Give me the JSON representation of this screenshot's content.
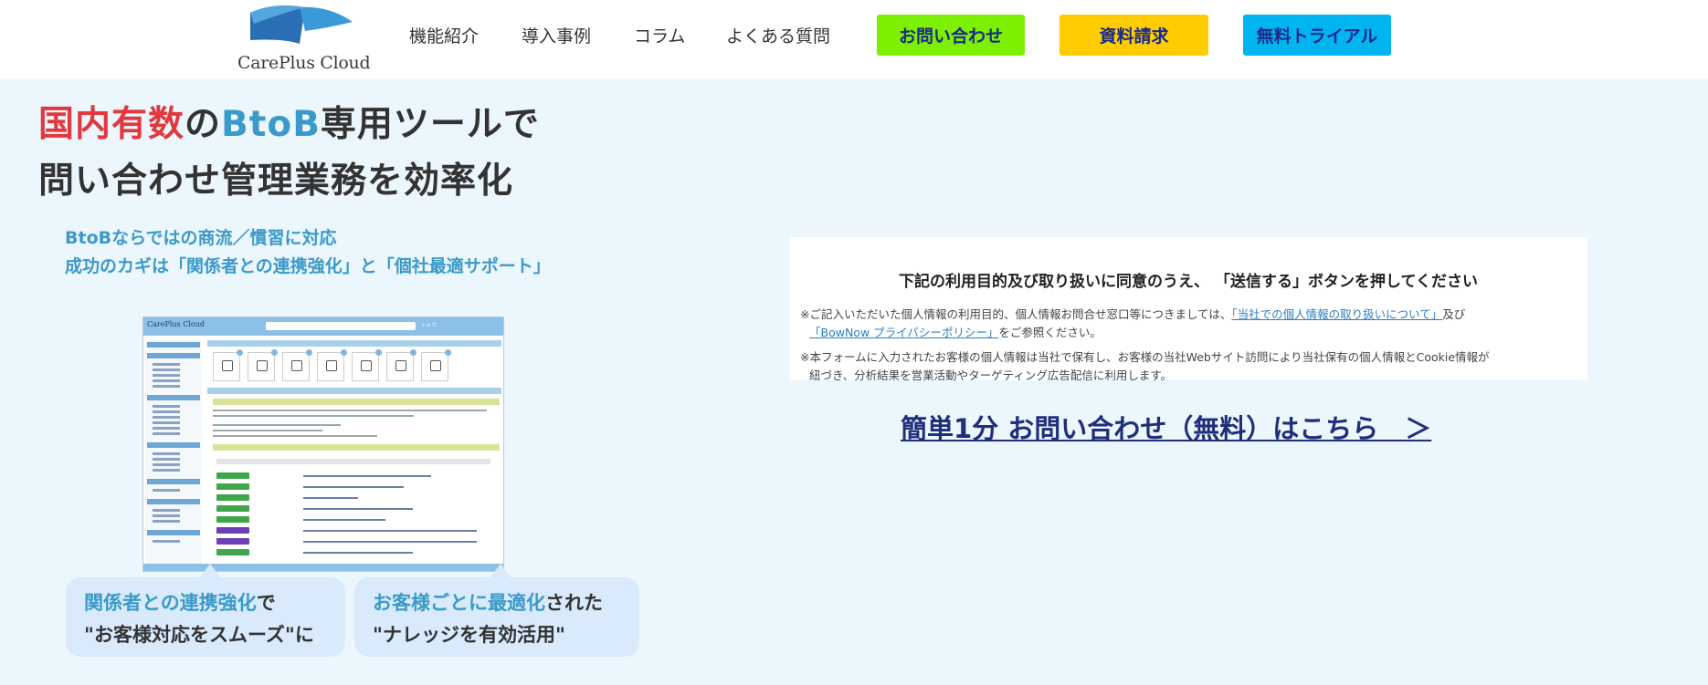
{
  "header": {
    "logo_text": "CarePlus Cloud",
    "nav": [
      "機能紹介",
      "導入事例",
      "コラム",
      "よくある質問"
    ],
    "buttons": {
      "contact": "お問い合わせ",
      "materials": "資料請求",
      "trial": "無料トライアル"
    },
    "colors": {
      "contact": "#7cf000",
      "materials": "#ffcc00",
      "trial": "#00b4f0"
    }
  },
  "hero": {
    "line1": {
      "part1": "国内有数",
      "part2": "の",
      "part3": "BtoB",
      "part4": "専用ツールで"
    },
    "line2": "問い合わせ管理業務を効率化",
    "sub1": "BtoBならではの商流／慣習に対応",
    "sub2": "成功のカギは「関係者との連携強化」と「個社最適サポート」"
  },
  "mock": {
    "logo": "CarePlus Cloud"
  },
  "callouts": [
    {
      "highlight": "関係者との連携強化",
      "rest": "で",
      "line2": "\"お客様対応をスムーズ\"に"
    },
    {
      "highlight": "お客様ごとに最適化",
      "rest": "された",
      "line2": "\"ナレッジを有効活用\""
    }
  ],
  "consent": {
    "title": "下記の利用目的及び取り扱いに同意のうえ、 「送信する」ボタンを押してください",
    "p1_pre": "※ご記入いただいた個人情報の利用目的、個人情報お問合せ窓口等につきましては、",
    "p1_link1": "「当社での個人情報の取り扱いについて」",
    "p1_mid": "及び",
    "p1_link2": "「BowNow プライバシーポリシー」",
    "p1_post": "をご参照ください。",
    "p2_line1": "※本フォームに入力されたお客様の個人情報は当社で保有し、お客様の当社Webサイト訪問により当社保有の個人情報とCookie情報が",
    "p2_line2": "紐づき、分析結果を営業活動やターゲティング広告配信に利用します。"
  },
  "cta": "簡単1分 お問い合わせ（無料）はこちら　＞"
}
